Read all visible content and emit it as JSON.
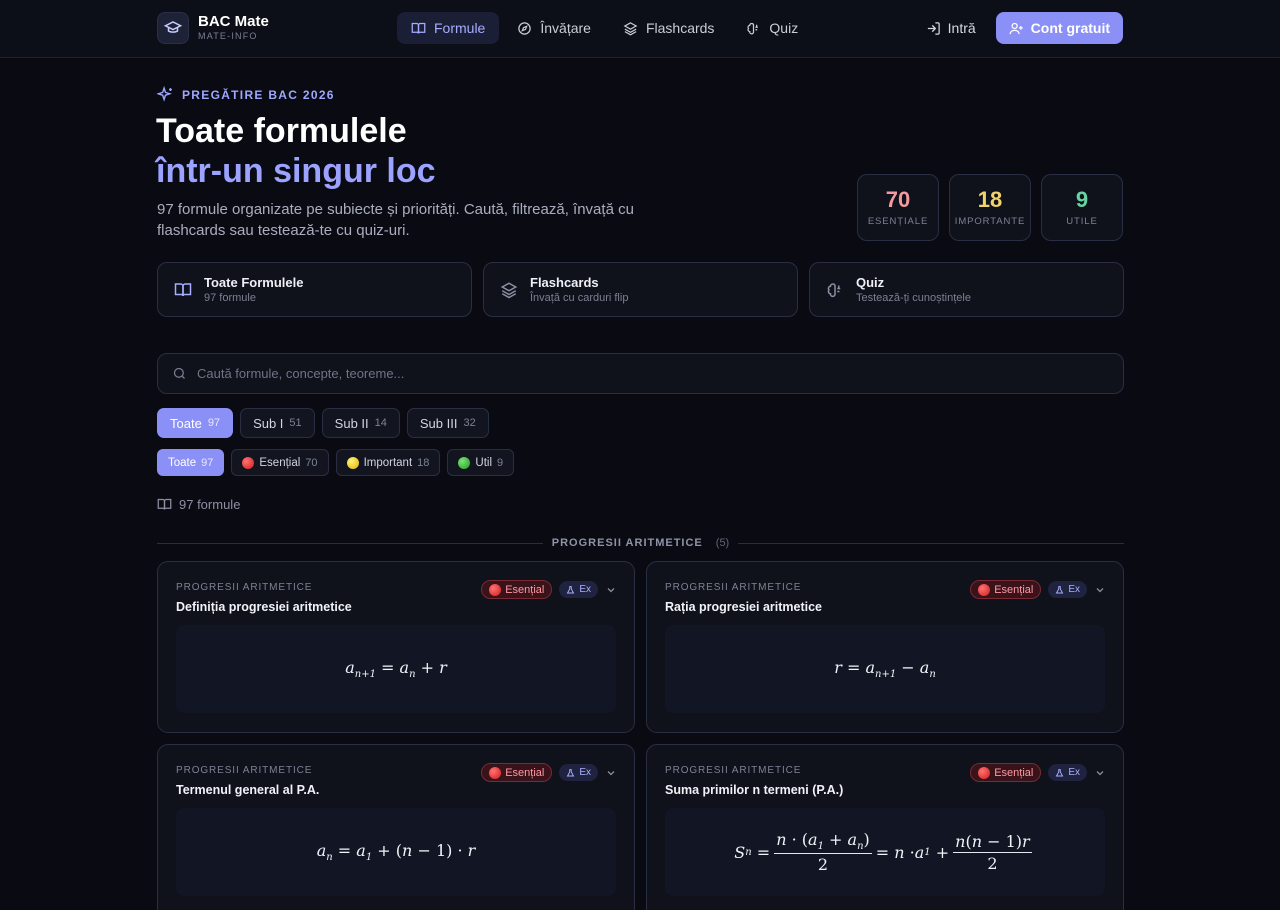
{
  "nav": {
    "brand_name": "BAC Mate",
    "brand_sub": "MATE-INFO",
    "links": [
      {
        "label": "Formule",
        "icon": "book-icon",
        "active": true
      },
      {
        "label": "Învățare",
        "icon": "compass-icon",
        "active": false
      },
      {
        "label": "Flashcards",
        "icon": "layers-icon",
        "active": false
      },
      {
        "label": "Quiz",
        "icon": "brain-icon",
        "active": false
      }
    ],
    "login_label": "Intră",
    "signup_label": "Cont gratuit"
  },
  "hero": {
    "eyebrow": "PREGĂTIRE BAC 2026",
    "title_line1": "Toate formulele",
    "title_line2": "într-un singur loc",
    "lead": "97 formule organizate pe subiecte și priorități. Caută, filtrează, învață cu flashcards sau testează-te cu quiz-uri."
  },
  "stats": [
    {
      "value": "70",
      "label": "ESENȚIALE",
      "color": "#f39a9f"
    },
    {
      "value": "18",
      "label": "IMPORTANTE",
      "color": "#f1d36a"
    },
    {
      "value": "9",
      "label": "UTILE",
      "color": "#67d4a3"
    }
  ],
  "quick_cards": [
    {
      "title": "Toate Formulele",
      "subtitle": "97 formule",
      "icon": "book-icon"
    },
    {
      "title": "Flashcards",
      "subtitle": "Învață cu carduri flip",
      "icon": "layers-icon"
    },
    {
      "title": "Quiz",
      "subtitle": "Testează-ți cunoștințele",
      "icon": "brain-icon"
    }
  ],
  "search": {
    "placeholder": "Caută formule, concepte, teoreme...",
    "value": ""
  },
  "subject_filters": [
    {
      "label": "Toate",
      "count": "97",
      "active": true
    },
    {
      "label": "Sub I",
      "count": "51",
      "active": false
    },
    {
      "label": "Sub II",
      "count": "14",
      "active": false
    },
    {
      "label": "Sub III",
      "count": "32",
      "active": false
    }
  ],
  "priority_filters": [
    {
      "label": "Toate",
      "count": "97",
      "active": true,
      "dot": null
    },
    {
      "label": "Esențial",
      "count": "70",
      "active": false,
      "dot": "red"
    },
    {
      "label": "Important",
      "count": "18",
      "active": false,
      "dot": "yellow"
    },
    {
      "label": "Util",
      "count": "9",
      "active": false,
      "dot": "green"
    }
  ],
  "result_count": "97 formule",
  "section": {
    "title": "PROGRESII ARITMETICE",
    "count": "(5)"
  },
  "formulas": [
    {
      "category": "PROGRESII ARITMETICE",
      "title": "Definiția progresiei aritmetice",
      "badge": "Esențial",
      "ex": "Ex"
    },
    {
      "category": "PROGRESII ARITMETICE",
      "title": "Rația progresiei aritmetice",
      "badge": "Esențial",
      "ex": "Ex"
    },
    {
      "category": "PROGRESII ARITMETICE",
      "title": "Termenul general al P.A.",
      "badge": "Esențial",
      "ex": "Ex"
    },
    {
      "category": "PROGRESII ARITMETICE",
      "title": "Suma primilor n termeni (P.A.)",
      "badge": "Esențial",
      "ex": "Ex"
    }
  ]
}
